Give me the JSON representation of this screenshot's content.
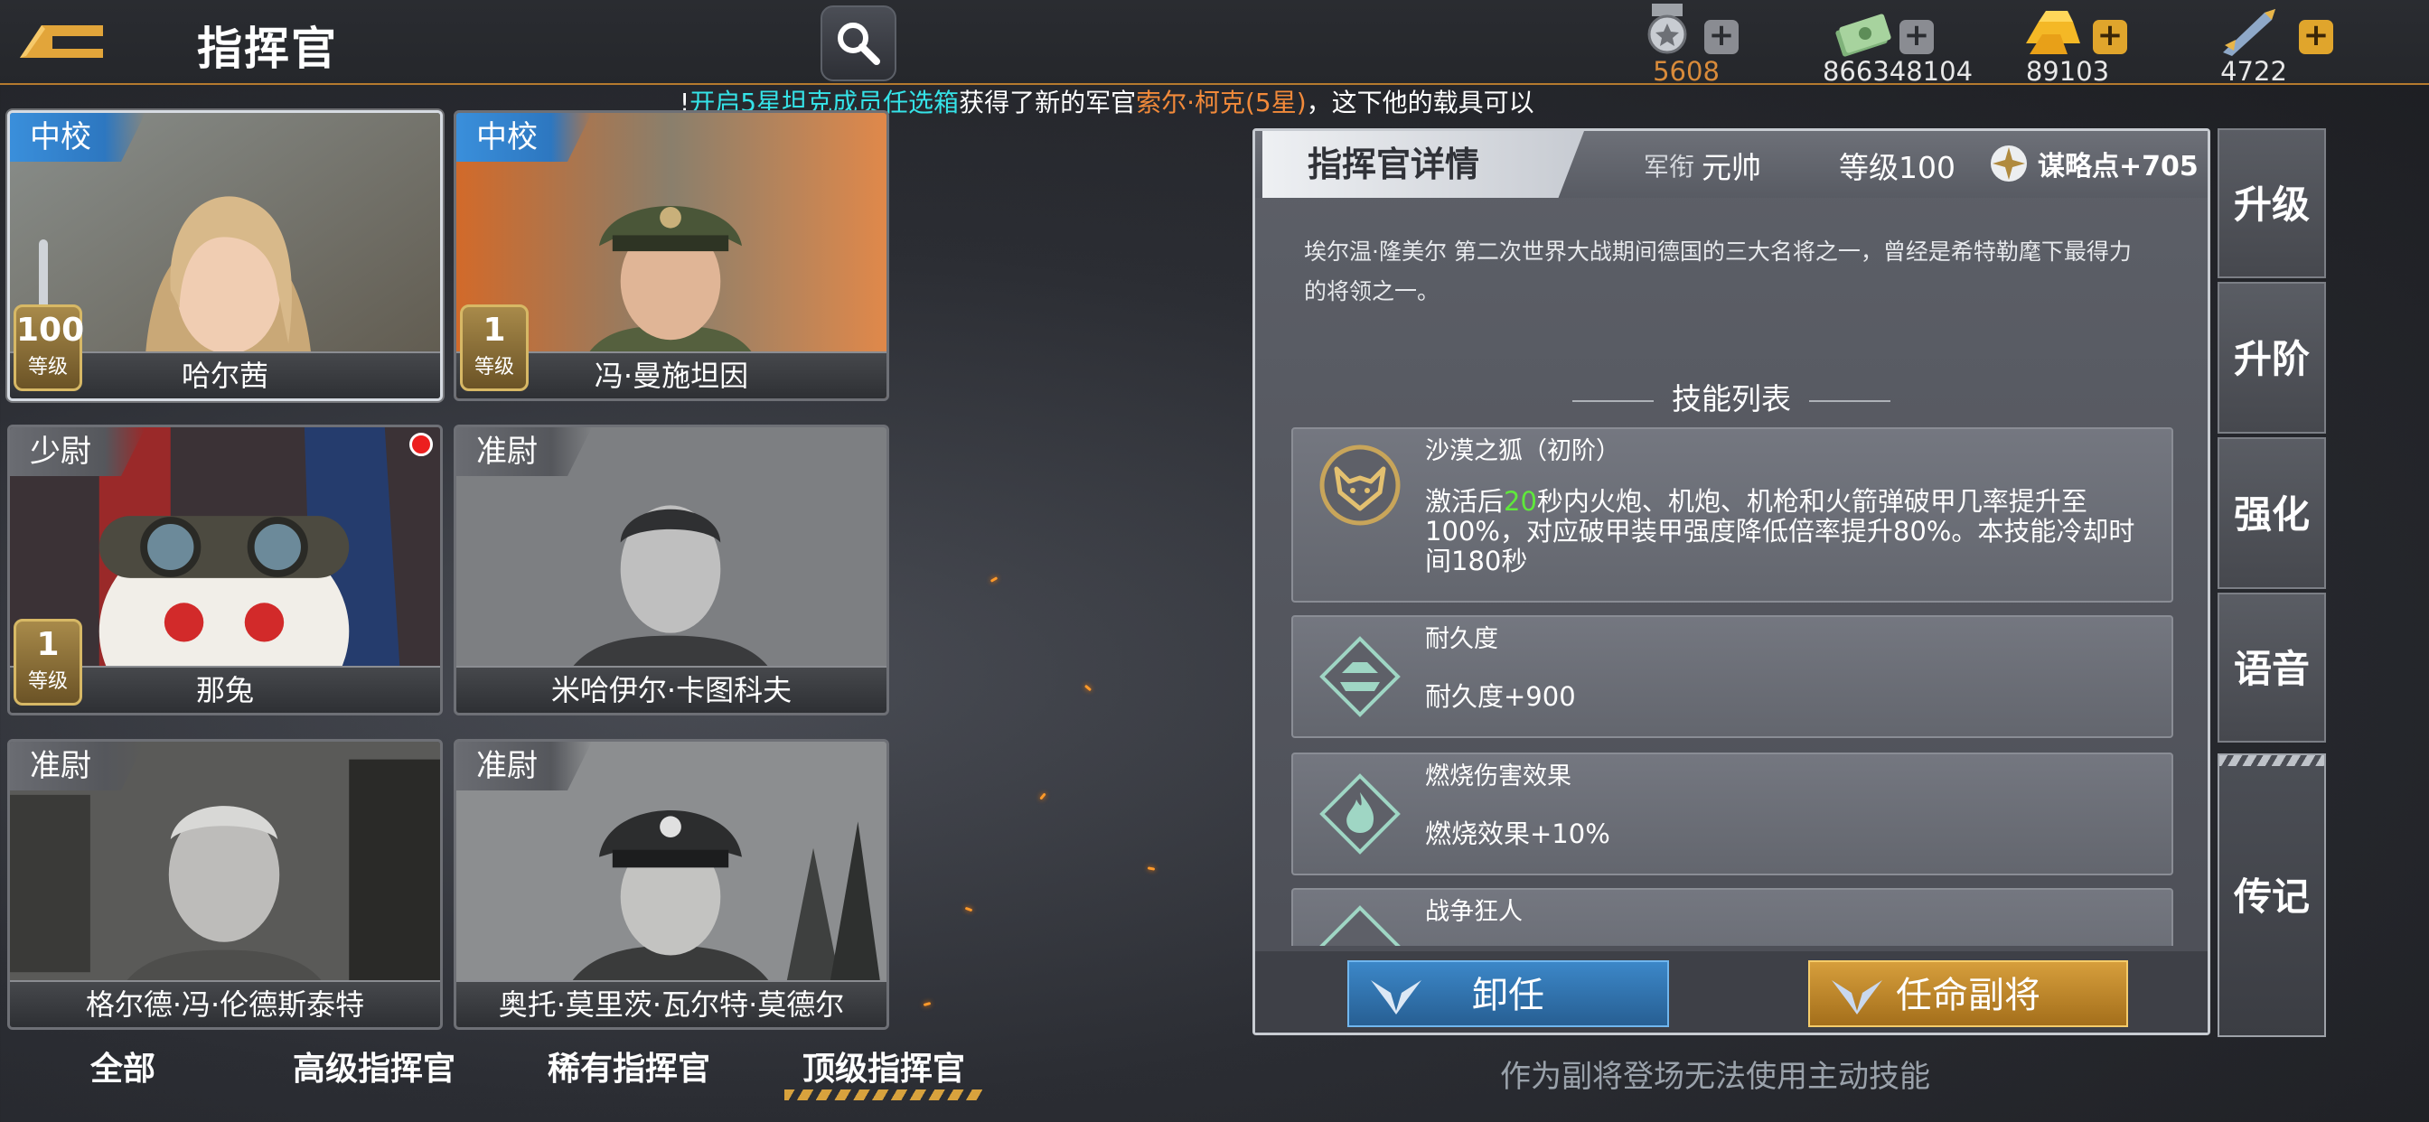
{
  "header": {
    "title": "指挥官",
    "resources": [
      {
        "icon": "medal-icon",
        "value": "5608",
        "color": "#d98b3a",
        "plus": "+"
      },
      {
        "icon": "cash-icon",
        "value": "866348104",
        "color": "#e6e6e6",
        "plus": "+"
      },
      {
        "icon": "gold-bar-icon",
        "value": "89103",
        "color": "#e6e6e6",
        "plus": "+"
      },
      {
        "icon": "rocket-icon",
        "value": "4722",
        "color": "#e6e6e6",
        "plus": "+"
      }
    ]
  },
  "ticker": {
    "lead": "!",
    "part1": "开启5星坦克成员任选箱",
    "part2": "获得了新的军官",
    "part3": "索尔·柯克(5星)",
    "part4": "，这下他的载具可以"
  },
  "commanders": [
    {
      "rank": "中校",
      "name": "哈尔茜",
      "level": "100",
      "level_label": "等级",
      "rank_style": "blue"
    },
    {
      "rank": "中校",
      "name": "冯·曼施坦因",
      "level": "1",
      "level_label": "等级",
      "rank_style": "blue"
    },
    {
      "rank": "少尉",
      "name": "那兔",
      "level": "1",
      "level_label": "等级",
      "rank_style": "gray"
    },
    {
      "rank": "准尉",
      "name": "米哈伊尔·卡图科夫",
      "rank_style": "gray"
    },
    {
      "rank": "准尉",
      "name": "格尔德·冯·伦德斯泰特",
      "rank_style": "gray"
    },
    {
      "rank": "准尉",
      "name": "奥托·莫里茨·瓦尔特·莫德尔",
      "rank_style": "gray"
    }
  ],
  "filters": {
    "all": "全部",
    "senior": "高级指挥官",
    "rare": "稀有指挥官",
    "top": "顶级指挥官"
  },
  "detail": {
    "title": "指挥官详情",
    "rank_label": "军衔",
    "rank_value": "元帅",
    "level_text": "等级100",
    "points": "谋略点+705",
    "bio": "埃尔温·隆美尔 第二次世界大战期间德国的三大名将之一，曾经是希特勒麾下最得力的将领之一。",
    "skills_title": "技能列表",
    "skills": [
      {
        "icon": "fox-icon",
        "name": "沙漠之狐（初阶）",
        "desc_a": "激活后",
        "desc_hl": "20",
        "desc_b": "秒内火炮、机炮、机枪和火箭弹破甲几率提升至100%，对应破甲装甲强度降低倍率提升80%。本技能冷却时间180秒"
      },
      {
        "icon": "durability-icon",
        "name": "耐久度",
        "desc": "耐久度+900"
      },
      {
        "icon": "burn-icon",
        "name": "燃烧伤害效果",
        "desc": "燃烧效果+10%"
      },
      {
        "icon": "war-fanatic-icon",
        "name": "战争狂人"
      }
    ],
    "dismiss": "卸任",
    "appoint": "任命副将",
    "note": "作为副将登场无法使用主动技能"
  },
  "side_tabs": [
    "升级",
    "升阶",
    "强化",
    "语音",
    "传记"
  ]
}
